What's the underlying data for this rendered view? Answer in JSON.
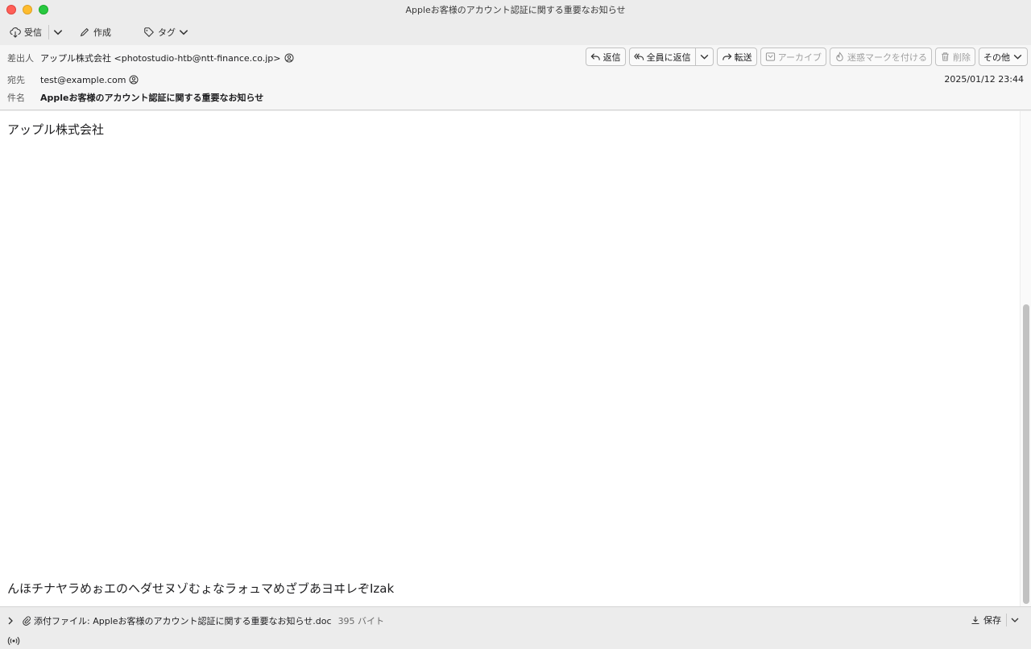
{
  "window": {
    "title": "Appleお客様のアカウント認証に関する重要なお知らせ"
  },
  "toolbar": {
    "get_mail": "受信",
    "compose": "作成",
    "tag": "タグ"
  },
  "header": {
    "from_label": "差出人",
    "from_value": "アップル株式会社 <photostudio-htb@ntt-finance.co.jp>",
    "to_label": "宛先",
    "to_value": "test@example.com",
    "subject_label": "件名",
    "subject_value": "Appleお客様のアカウント認証に関する重要なお知らせ",
    "date": "2025/01/12 23:44"
  },
  "actions": {
    "reply": "返信",
    "reply_all": "全員に返信",
    "forward": "転送",
    "archive": "アーカイブ",
    "junk": "迷惑マークを付ける",
    "delete": "削除",
    "more": "その他"
  },
  "message": {
    "line1": "アップル株式会社",
    "line2": "んほチナヤラめぉエのヘダせヌゾむょなラォュマめざブあヨヰレぞIzak"
  },
  "attachment": {
    "label": "添付ファイル: Appleお客様のアカウント認証に関する重要なお知らせ.doc",
    "size": "395 バイト",
    "save": "保存"
  },
  "colors": {
    "close": "#ff5f57",
    "minimize": "#febc2e",
    "maximize": "#28c840"
  },
  "icons": [
    "get-mail-icon",
    "compose-icon",
    "tag-icon",
    "reply-icon",
    "reply-all-icon",
    "forward-icon",
    "archive-icon",
    "junk-icon",
    "trash-icon",
    "paperclip-icon",
    "download-icon",
    "activity-icon",
    "person-icon"
  ]
}
